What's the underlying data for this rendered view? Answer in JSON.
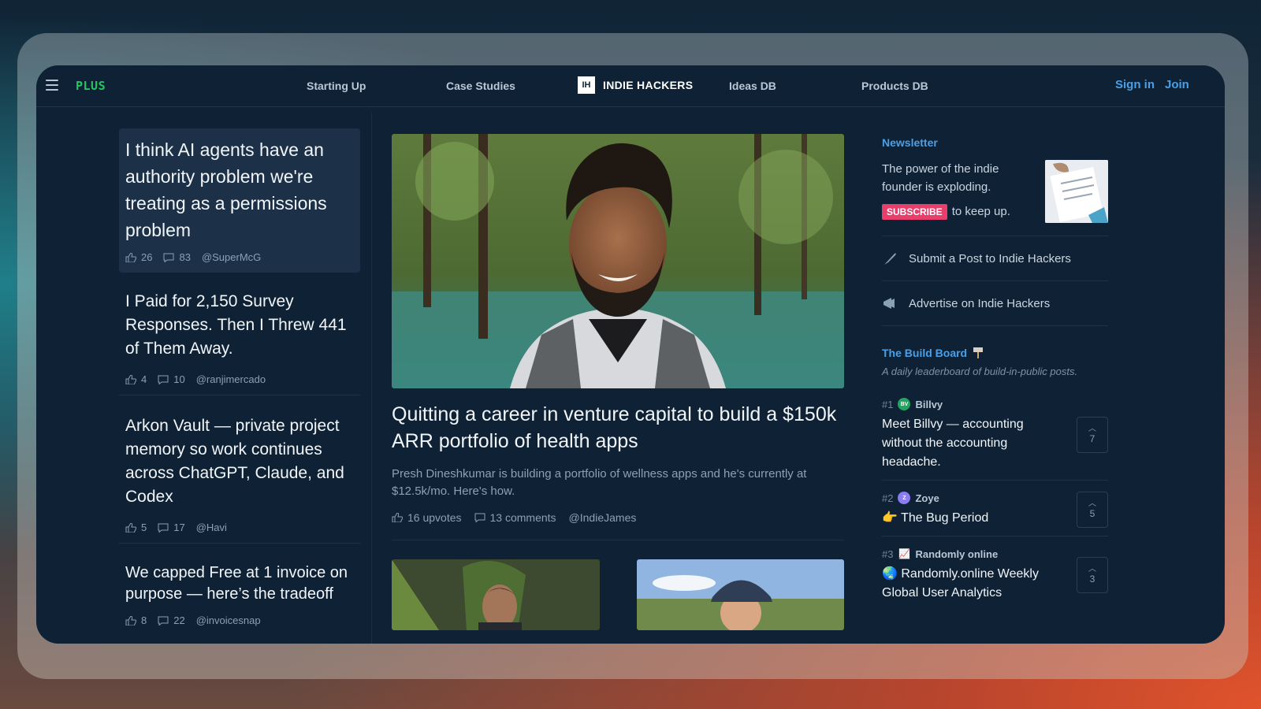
{
  "nav": {
    "plus": "PLUS",
    "links": [
      "Starting Up",
      "Case Studies",
      "Ideas DB",
      "Products DB"
    ],
    "brand_box": "IH",
    "brand": "INDIE HACKERS",
    "sign_in": "Sign in",
    "join": "Join"
  },
  "left_posts": [
    {
      "title": "I think AI agents have an authority problem we're treating as a permissions problem",
      "likes": "26",
      "comments": "83",
      "author": "@SuperMcG"
    },
    {
      "title": "I Paid for 2,150 Survey Responses. Then I Threw 441 of Them Away.",
      "likes": "4",
      "comments": "10",
      "author": "@ranjimercado"
    },
    {
      "title": "Arkon Vault — private project memory so work continues across ChatGPT, Claude, and Codex",
      "likes": "5",
      "comments": "17",
      "author": "@Havi"
    },
    {
      "title": "We capped Free at 1 invoice on purpose — here’s the tradeoff",
      "likes": "8",
      "comments": "22",
      "author": "@invoicesnap"
    }
  ],
  "featured": {
    "title": "Quitting a career in venture capital to build a $150k ARR portfolio of health apps",
    "description": "Presh Dineshkumar is building a portfolio of wellness apps and he's currently at $12.5k/mo. Here's how.",
    "upvotes": "16 upvotes",
    "comments": "13 comments",
    "author": "@IndieJames"
  },
  "newsletter": {
    "heading": "Newsletter",
    "text": "The power of the indie founder is exploding.",
    "subscribe": "SUBSCRIBE",
    "suffix": "to keep up."
  },
  "actions": {
    "submit": "Submit a Post to Indie Hackers",
    "advertise": "Advertise on Indie Hackers"
  },
  "build_board": {
    "heading": "The Build Board",
    "description": "A daily leaderboard of build-in-public posts.",
    "items": [
      {
        "rank": "#1",
        "avatar": "BV",
        "name": "Billvy",
        "title": "Meet Billvy — accounting without the accounting headache.",
        "votes": "7",
        "color": "#22a55e"
      },
      {
        "rank": "#2",
        "avatar": "Z",
        "name": "Zoye",
        "title": "👉 The Bug Period",
        "votes": "5",
        "color": "#8b7cf0"
      },
      {
        "rank": "#3",
        "avatar": "📈",
        "name": "Randomly online",
        "title": "🌏 Randomly.online Weekly Global User Analytics",
        "votes": "3",
        "color": "#0f2235"
      }
    ]
  },
  "colors": {
    "accent": "#4b9fe6",
    "plus": "#22c55e",
    "subscribe": "#e83e6c",
    "background": "#0f2235"
  }
}
